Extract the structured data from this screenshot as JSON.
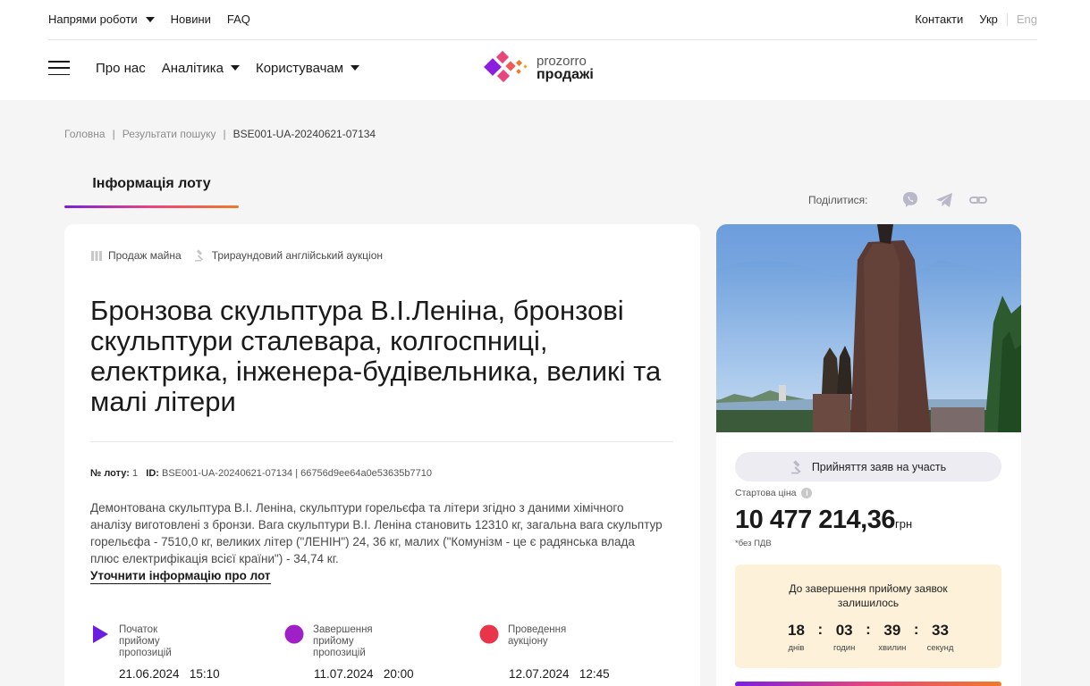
{
  "topbar": {
    "left": [
      {
        "label": "Напрями роботи",
        "dropdown": true
      },
      {
        "label": "Новини",
        "dropdown": false
      },
      {
        "label": "FAQ",
        "dropdown": false
      }
    ],
    "contacts": "Контакти",
    "lang_active": "Укр",
    "lang_inactive": "Eng"
  },
  "nav": {
    "about": "Про нас",
    "analytics": "Аналітика",
    "users": "Користувачам"
  },
  "logo": {
    "line1": "prozorro",
    "line2": "продажі"
  },
  "breadcrumb": {
    "home": "Головна",
    "results": "Результати пошуку",
    "current": "BSE001-UA-20240621-07134",
    "sep": "|"
  },
  "tab": {
    "label": "Інформація лоту"
  },
  "share": {
    "label": "Поділитися:"
  },
  "lot": {
    "tag_sale": "Продаж майна",
    "tag_auction": "Трираундовий англійський аукціон",
    "title": "Бронзова скульптура В.І.Леніна, бронзові скульптури сталевара, колгоспниці, електрика, інженера-будівельника, великі та малі літери",
    "lot_no_label": "№ лоту:",
    "lot_no": "1",
    "id_label": "ID:",
    "id": "BSE001-UA-20240621-07134",
    "hash": "66756d9ee64a0e53635b7710",
    "meta_sep": "|",
    "description": "Демонтована скульптура В.І. Леніна, скульптури горельєфа та літери згідно з даними хімічного аналізу виготовлені з бронзи. Вага скульптури В.І. Леніна становить 12310 кг, загальна вага скульптур горельєфа - 7510,0 кг, великих літер (\"ЛЕНІН\") 24, 36 кг, малих (\"Комунізм - це є радянська влада плюс електрифікація всієї країни\") - 34,74 кг.",
    "more_link": "Уточнити інформацію про лот"
  },
  "timeline": [
    {
      "label_lines": [
        "Початок",
        "прийому",
        "пропозицій"
      ],
      "date": "21.06.2024",
      "time": "15:10",
      "color": "#6b1ee0",
      "shape": "triangle"
    },
    {
      "label_lines": [
        "Завершення",
        "прийому",
        "пропозицій"
      ],
      "date": "11.07.2024",
      "time": "20:00",
      "color": "#a020c8",
      "shape": "circle"
    },
    {
      "label_lines": [
        "Проведення",
        "аукціону"
      ],
      "date": "12.07.2024",
      "time": "12:45",
      "color": "#e8354a",
      "shape": "circle"
    }
  ],
  "side": {
    "status": "Прийняття заяв на участь",
    "price_label": "Стартова ціна",
    "price": "10 477 214,36",
    "currency": "грн",
    "vat": "*без ПДВ",
    "countdown_title_1": "До завершення прийому заявок",
    "countdown_title_2": "залишилось",
    "countdown": [
      {
        "value": "18",
        "unit": "днів"
      },
      {
        "value": "03",
        "unit": "годин"
      },
      {
        "value": "39",
        "unit": "хвилин"
      },
      {
        "value": "33",
        "unit": "секунд"
      }
    ]
  },
  "colors": {
    "accent": "#7a1fe0",
    "accent2": "#e8457c",
    "accent3": "#f07a2a",
    "countdown_bg": "#fdf1d9"
  }
}
